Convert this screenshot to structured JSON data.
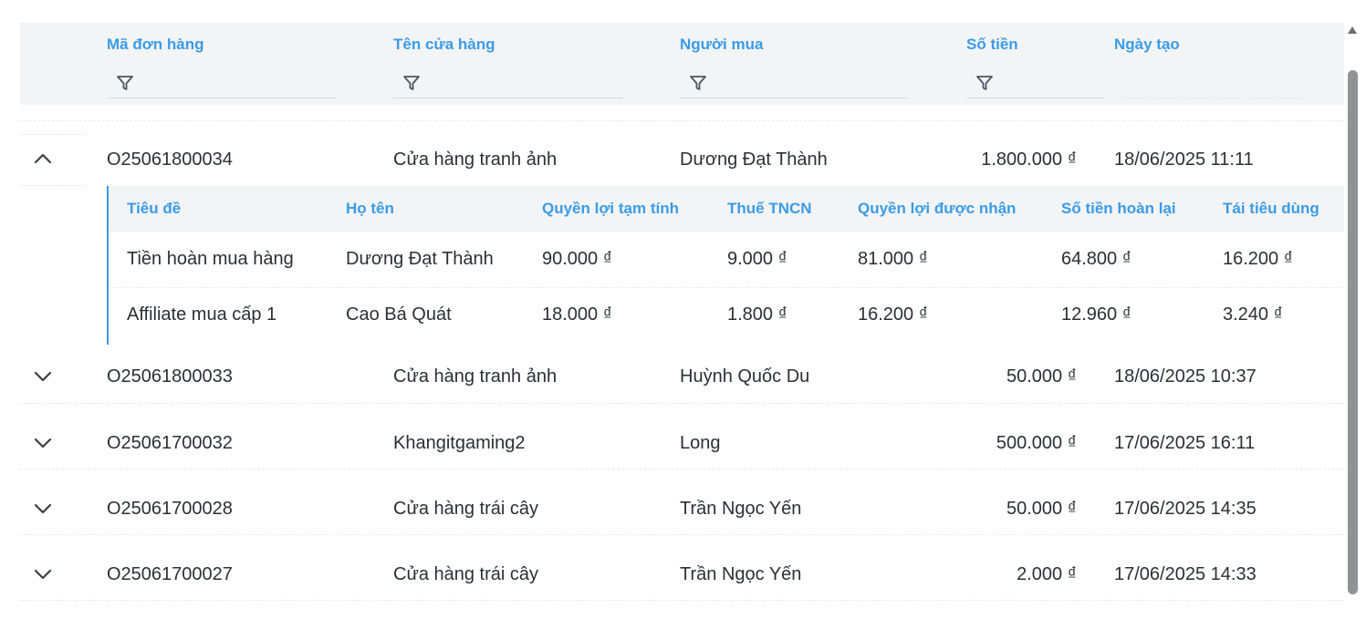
{
  "columns": {
    "order_id": "Mã đơn hàng",
    "store_name": "Tên cửa hàng",
    "buyer": "Người mua",
    "amount": "Số tiền",
    "created": "Ngày tạo"
  },
  "orders": [
    {
      "id": "O25061800034",
      "store": "Cửa hàng tranh ảnh",
      "buyer": "Dương Đạt Thành",
      "amount": "1.800.000 ₫",
      "created": "18/06/2025 11:11",
      "expanded": true
    },
    {
      "id": "O25061800033",
      "store": "Cửa hàng tranh ảnh",
      "buyer": "Huỳnh Quốc Du",
      "amount": "50.000 ₫",
      "created": "18/06/2025 10:37",
      "expanded": false
    },
    {
      "id": "O25061700032",
      "store": "Khangitgaming2",
      "buyer": "Long",
      "amount": "500.000 ₫",
      "created": "17/06/2025 16:11",
      "expanded": false
    },
    {
      "id": "O25061700028",
      "store": "Cửa hàng trái cây",
      "buyer": "Trần Ngọc Yến",
      "amount": "50.000 ₫",
      "created": "17/06/2025 14:35",
      "expanded": false
    },
    {
      "id": "O25061700027",
      "store": "Cửa hàng trái cây",
      "buyer": "Trần Ngọc Yến",
      "amount": "2.000 ₫",
      "created": "17/06/2025 14:33",
      "expanded": false
    }
  ],
  "sub_columns": {
    "title": "Tiêu đề",
    "full_name": "Họ tên",
    "provisional": "Quyền lợi tạm tính",
    "pit": "Thuế TNCN",
    "received": "Quyền lợi được nhận",
    "refund": "Số tiền hoàn lại",
    "reuse": "Tái tiêu dùng"
  },
  "sub_rows": [
    {
      "title": "Tiền hoàn mua hàng",
      "full_name": "Dương Đạt Thành",
      "provisional": "90.000 ₫",
      "pit": "9.000 ₫",
      "received": "81.000 ₫",
      "refund": "64.800 ₫",
      "reuse": "16.200 ₫"
    },
    {
      "title": "Affiliate mua cấp 1",
      "full_name": "Cao Bá Quát",
      "provisional": "18.000 ₫",
      "pit": "1.800 ₫",
      "received": "16.200 ₫",
      "refund": "12.960 ₫",
      "reuse": "3.240 ₫"
    }
  ],
  "colors": {
    "accent": "#3b9be8",
    "header_bg": "#f3f4f6",
    "text": "#2b2f36"
  },
  "icons": {
    "filter": "filter-icon",
    "expand": "chevron-down-icon",
    "collapse": "chevron-up-icon"
  }
}
